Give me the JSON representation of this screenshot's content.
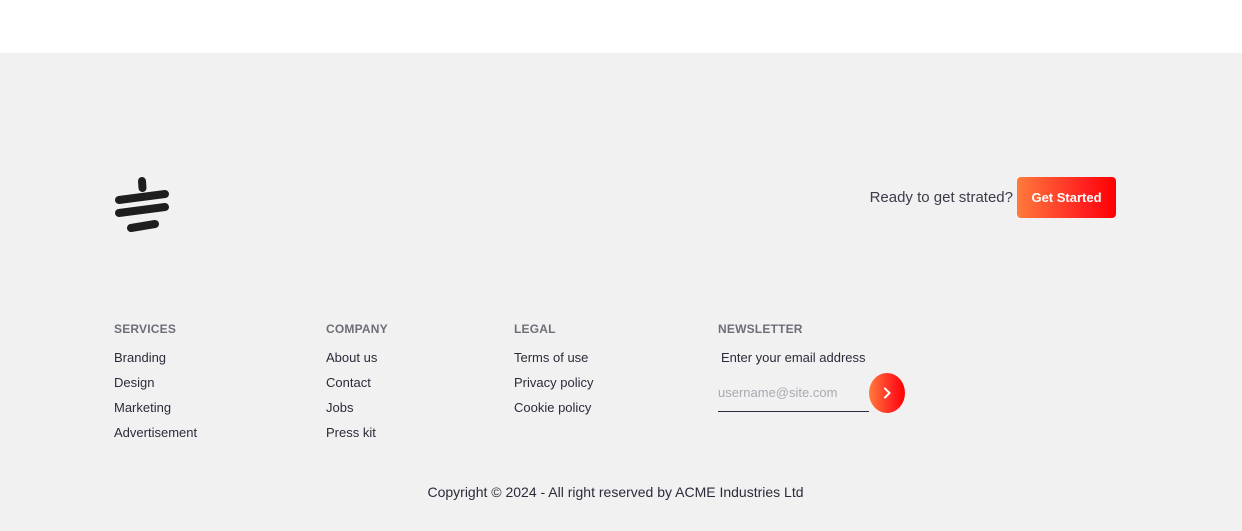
{
  "cta": {
    "text": "Ready to get strated?",
    "button_label": "Get Started"
  },
  "columns": {
    "services": {
      "title": "SERVICES",
      "items": [
        "Branding",
        "Design",
        "Marketing",
        "Advertisement"
      ]
    },
    "company": {
      "title": "COMPANY",
      "items": [
        "About us",
        "Contact",
        "Jobs",
        "Press kit"
      ]
    },
    "legal": {
      "title": "LEGAL",
      "items": [
        "Terms of use",
        "Privacy policy",
        "Cookie policy"
      ]
    },
    "newsletter": {
      "title": "NEWSLETTER",
      "label": "Enter your email address",
      "placeholder": "username@site.com",
      "submit_icon": "chevron-right-icon"
    }
  },
  "copyright": "Copyright © 2024 - All right reserved by ACME Industries Ltd",
  "colors": {
    "background": "#f1f1f1",
    "accent_start": "#ff7a3c",
    "accent_end": "#ff0000"
  },
  "logo_icon": "brand-logo-icon"
}
